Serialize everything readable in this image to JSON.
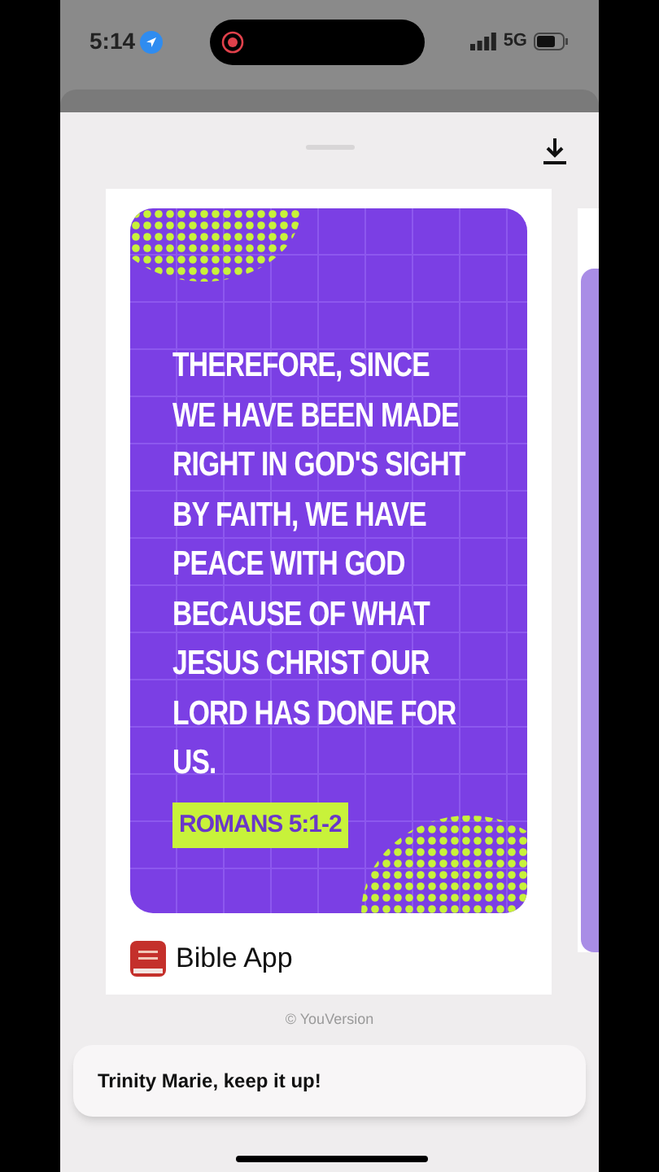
{
  "status_bar": {
    "time": "5:14",
    "network": "5G"
  },
  "verse_card": {
    "verse": "THEREFORE, SINCE WE HAVE BEEN MADE RIGHT IN GOD'S SIGHT BY FAITH, WE HAVE PEACE WITH GOD BECAUSE OF WHAT JESUS CHRIST OUR LORD HAS DONE FOR US.",
    "reference": "ROMANS 5:1-2",
    "app_name": "Bible App"
  },
  "copyright": "© YouVersion",
  "toast": {
    "message": "Trinity Marie, keep it up!"
  }
}
